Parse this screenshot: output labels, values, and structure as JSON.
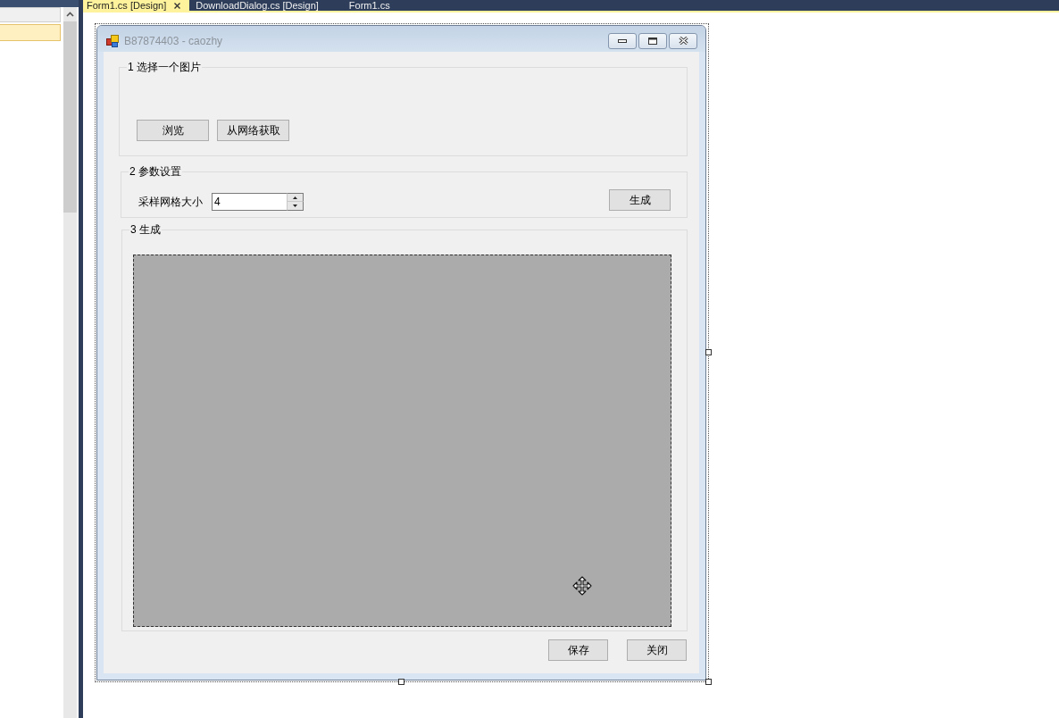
{
  "tool_panel": {
    "rows": [
      {
        "selected": true
      }
    ]
  },
  "editor_tabs": [
    {
      "label": "Form1.cs [Design]",
      "selected": true
    },
    {
      "label": "DownloadDialog.cs [Design]",
      "selected": false
    },
    {
      "label": "Form1.cs",
      "selected": false
    }
  ],
  "form": {
    "title": "B87874403 - caozhy",
    "groups": [
      {
        "kind": "buttons",
        "legend": "1 选择一个图片",
        "buttons": [
          "浏览",
          "从网络获取"
        ]
      },
      {
        "kind": "parameters",
        "legend": "2 参数设置",
        "label": "采样网格大小",
        "spinner": {
          "value": "4"
        },
        "button": "生成"
      },
      {
        "kind": "preview",
        "legend": "3 生成"
      }
    ],
    "buttons": [
      "保存",
      "关闭"
    ]
  }
}
